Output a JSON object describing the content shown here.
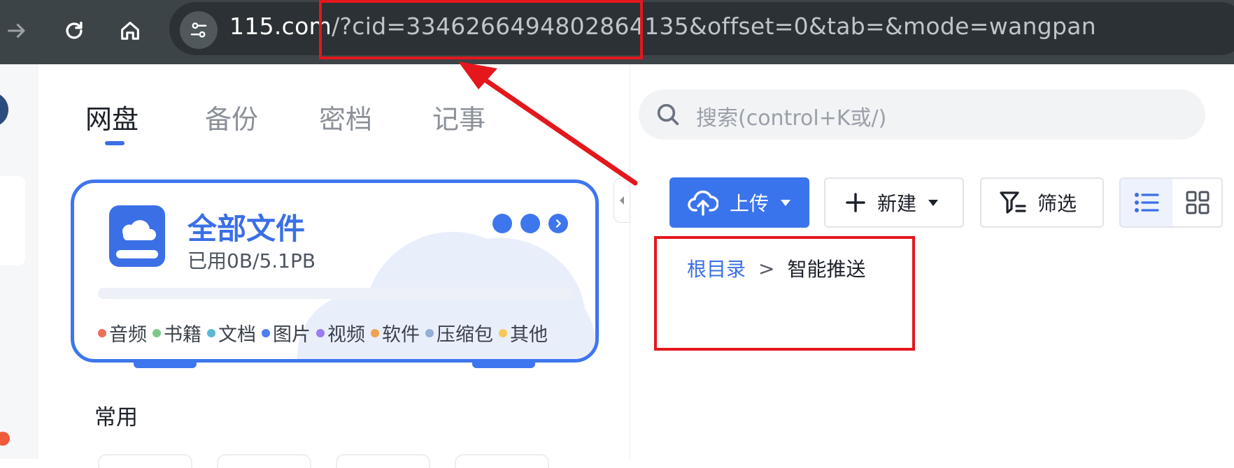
{
  "browser": {
    "url_host": "115.com",
    "url_path": "/?cid=3346266494802864135&offset=0&tab=&mode=wangpan"
  },
  "tabs": [
    {
      "label": "网盘"
    },
    {
      "label": "备份"
    },
    {
      "label": "密档"
    },
    {
      "label": "记事"
    }
  ],
  "search": {
    "placeholder": "搜索(control+K或/)"
  },
  "storage_card": {
    "title": "全部文件",
    "usage": "已用0B/5.1PB",
    "usage_fraction": 0,
    "legend": [
      {
        "label": "音频",
        "color": "#ee6f57"
      },
      {
        "label": "书籍",
        "color": "#7ec98a"
      },
      {
        "label": "文档",
        "color": "#5bb9d6"
      },
      {
        "label": "图片",
        "color": "#4f7ef0"
      },
      {
        "label": "视频",
        "color": "#9b7cf2"
      },
      {
        "label": "软件",
        "color": "#f0a24f"
      },
      {
        "label": "压缩包",
        "color": "#95aed6"
      },
      {
        "label": "其他",
        "color": "#f5c85a"
      }
    ]
  },
  "section": {
    "common_title": "常用"
  },
  "toolbar": {
    "upload_label": "上传",
    "new_label": "新建",
    "filter_label": "筛选"
  },
  "breadcrumb": {
    "root": "根目录",
    "separator": ">",
    "current": "智能推送"
  },
  "colors": {
    "accent": "#3a6fe6",
    "annotation": "#e4171d"
  }
}
